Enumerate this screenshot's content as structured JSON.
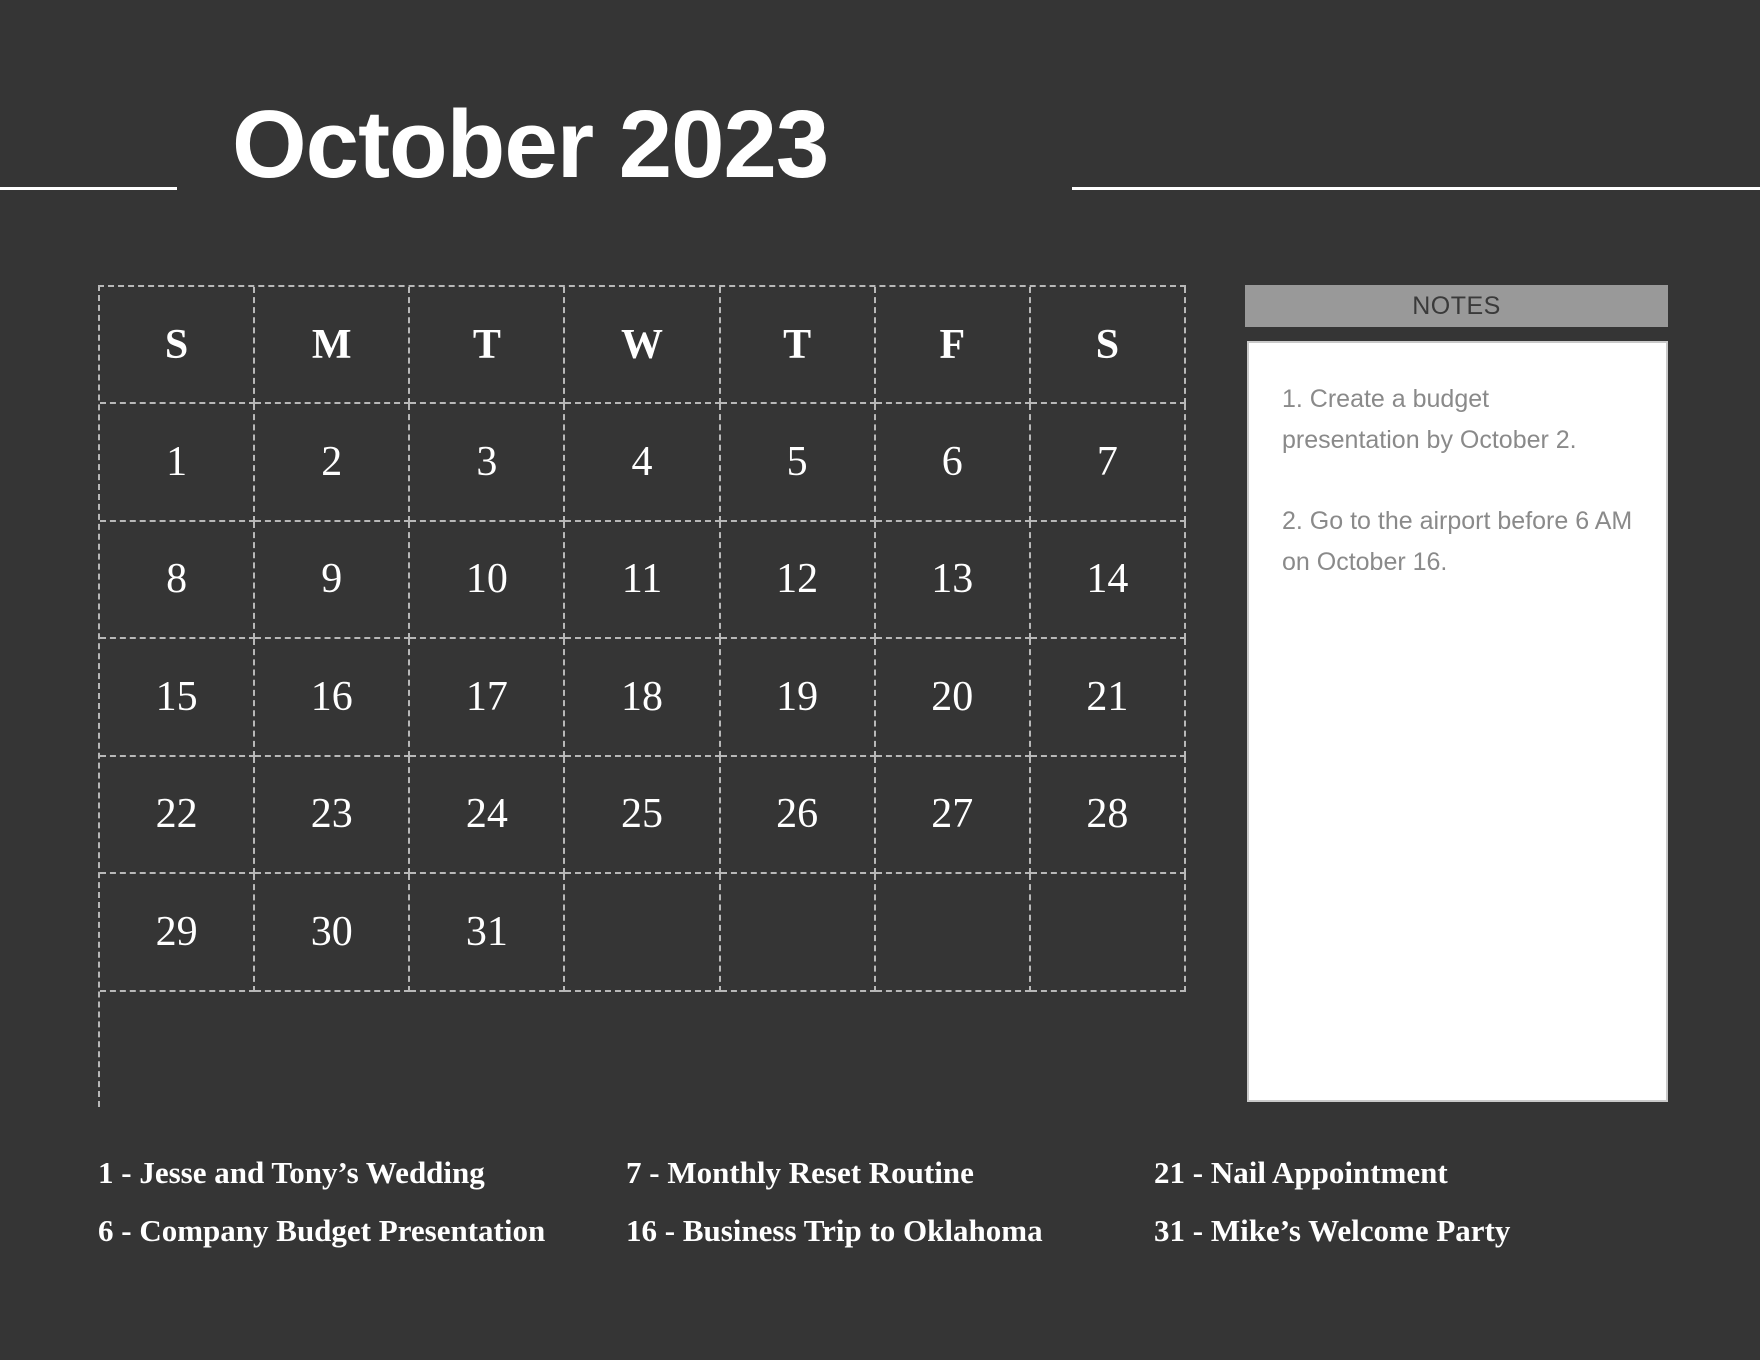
{
  "theme": {
    "background": "#353535",
    "text": "#ffffff",
    "accent_bar": "#999999",
    "panel_background": "#ffffff",
    "note_text": "#8a8a8a",
    "grid_line": "#b8b8b8"
  },
  "header": {
    "title": "October 2023"
  },
  "calendar": {
    "weekdays": [
      "S",
      "M",
      "T",
      "W",
      "T",
      "F",
      "S"
    ],
    "weeks": [
      [
        "1",
        "2",
        "3",
        "4",
        "5",
        "6",
        "7"
      ],
      [
        "8",
        "9",
        "10",
        "11",
        "12",
        "13",
        "14"
      ],
      [
        "15",
        "16",
        "17",
        "18",
        "19",
        "20",
        "21"
      ],
      [
        "22",
        "23",
        "24",
        "25",
        "26",
        "27",
        "28"
      ],
      [
        "29",
        "30",
        "31",
        "",
        "",
        "",
        ""
      ],
      [
        "",
        "",
        "",
        "",
        "",
        "",
        ""
      ]
    ]
  },
  "notes": {
    "title": "NOTES",
    "items": [
      "1. Create a budget presentation by October 2.",
      "2. Go to the airport before 6 AM on October 16."
    ]
  },
  "events": {
    "column_1": [
      "1 - Jesse and Tony’s Wedding",
      "6 - Company Budget Presentation"
    ],
    "column_2": [
      "7 - Monthly Reset Routine",
      "16 - Business Trip to Oklahoma"
    ],
    "column_3": [
      "21 - Nail Appointment",
      "31 - Mike’s Welcome Party"
    ]
  }
}
